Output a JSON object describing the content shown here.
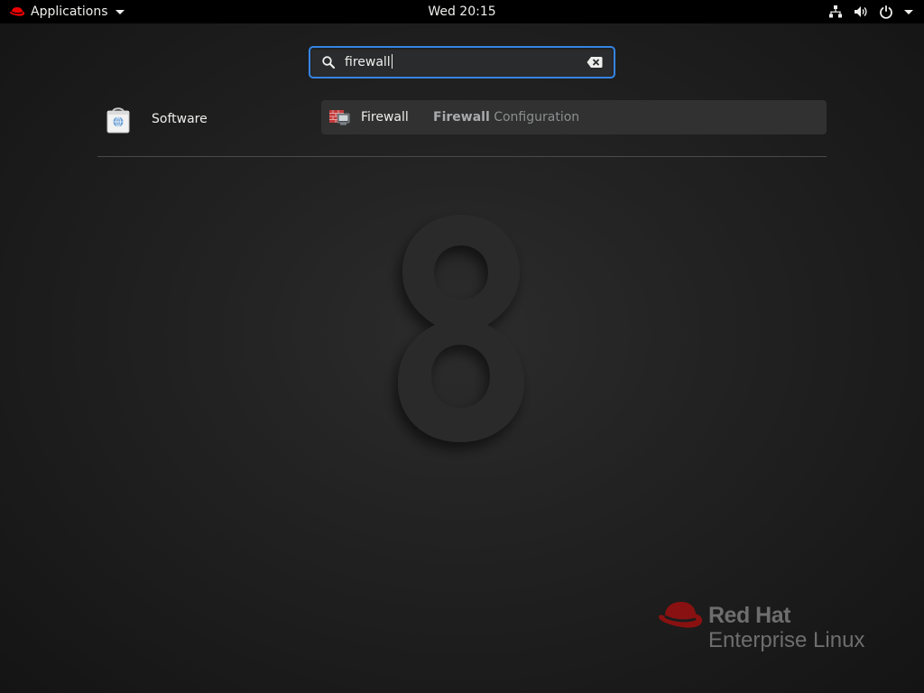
{
  "topbar": {
    "applications_label": "Applications",
    "clock": "Wed 20:15",
    "icons": [
      "redhat-logo-icon",
      "network-icon",
      "volume-icon",
      "power-icon",
      "chevron-down-icon"
    ]
  },
  "search": {
    "value": "firewall",
    "icons": [
      "search-icon",
      "clear-icon"
    ],
    "focus_color": "#3584e4"
  },
  "app_results": [
    {
      "label": "Software",
      "icon": "software-store-icon"
    }
  ],
  "provider_results": [
    {
      "name": "Firewall",
      "description_match": "Firewall",
      "description_rest": " Configuration",
      "icon": "firewall-icon"
    }
  ],
  "branding": {
    "line1": "Red Hat",
    "line2": "Enterprise Linux",
    "hat_color": "#8a1111",
    "background_mark": "8"
  }
}
